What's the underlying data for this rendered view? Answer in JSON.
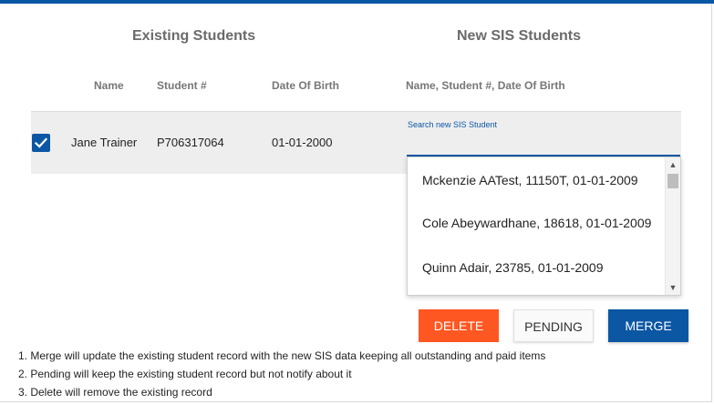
{
  "headers": {
    "existing_title": "Existing Students",
    "new_title": "New SIS Students",
    "col_name": "Name",
    "col_student_no": "Student #",
    "col_dob": "Date Of Birth",
    "col_new": "Name, Student #, Date Of Birth"
  },
  "row": {
    "checked": true,
    "name": "Jane Trainer",
    "student_no": "P706317064",
    "dob": "01-01-2000"
  },
  "search": {
    "label": "Search new SIS Student",
    "value": ""
  },
  "dropdown": {
    "items": [
      "Mckenzie AATest, 11150T, 01-01-2009",
      "Cole Abeywardhane, 18618, 01-01-2009",
      "Quinn Adair, 23785, 01-01-2009"
    ]
  },
  "buttons": {
    "delete": "DELETE",
    "pending": "PENDING",
    "merge": "MERGE"
  },
  "notes": [
    "1. Merge will update the existing student record with the new SIS data keeping all outstanding and paid items",
    "2. Pending will keep the existing student record but not notify about it",
    "3. Delete will remove the existing record"
  ],
  "colors": {
    "primary": "#0b57a4",
    "delete": "#fe5722"
  }
}
